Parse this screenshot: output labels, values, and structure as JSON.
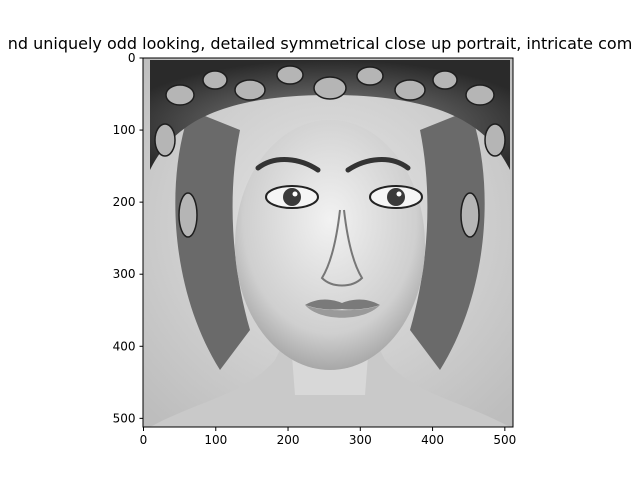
{
  "figure": {
    "title": "nd uniquely odd looking, detailed symmetrical close up portrait, intricate com",
    "image_subject": "black-and-white portrait of a woman wearing a headdress of intricate sea-creature ornaments",
    "colors": {
      "background": "#ffffff",
      "axes": "#000000",
      "image_bg": "#d9d9d9"
    }
  },
  "chart_data": {
    "type": "image",
    "title": "nd uniquely odd looking, detailed symmetrical close up portrait, intricate com",
    "xlabel": "",
    "ylabel": "",
    "xlim": [
      0,
      512
    ],
    "ylim": [
      512,
      0
    ],
    "x_ticks": [
      0,
      100,
      200,
      300,
      400,
      500
    ],
    "y_ticks": [
      0,
      100,
      200,
      300,
      400,
      500
    ],
    "grid": false
  }
}
